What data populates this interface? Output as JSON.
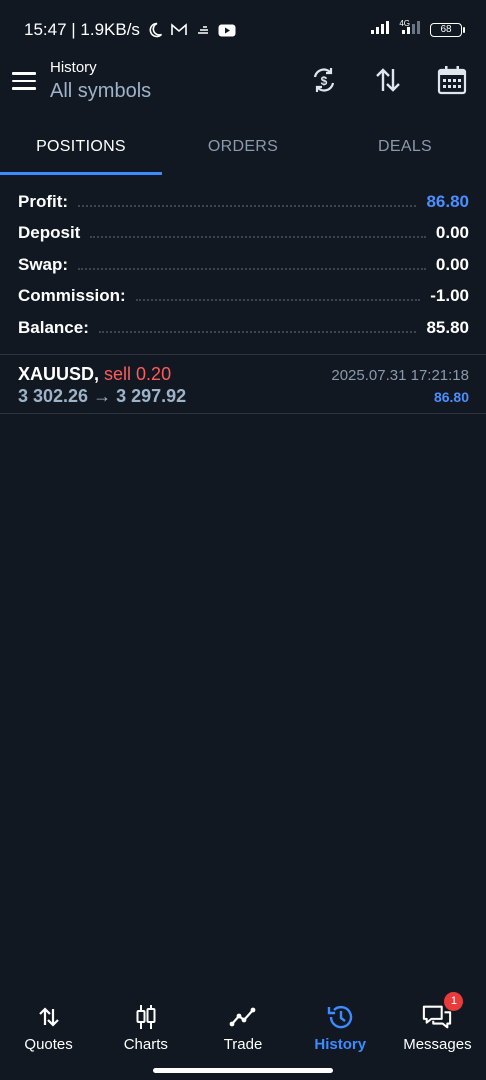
{
  "status_bar": {
    "time_speed": "15:47 | 1.9KB/s",
    "network_label": "4G",
    "battery": "68",
    "icons": [
      "moon-icon",
      "gmail-icon",
      "cloud-icon",
      "youtube-icon",
      "signal-icon",
      "signal-4g-icon",
      "battery-icon"
    ]
  },
  "app_bar": {
    "title": "History",
    "subtitle": "All symbols",
    "actions": [
      "currency-exchange-icon",
      "sort-icon",
      "calendar-icon"
    ]
  },
  "tabs": [
    {
      "label": "POSITIONS",
      "active": true
    },
    {
      "label": "ORDERS",
      "active": false
    },
    {
      "label": "DEALS",
      "active": false
    }
  ],
  "summary": [
    {
      "label": "Profit:",
      "value": "86.80",
      "highlight": true
    },
    {
      "label": "Deposit",
      "value": "0.00",
      "highlight": false
    },
    {
      "label": "Swap:",
      "value": "0.00",
      "highlight": false
    },
    {
      "label": "Commission:",
      "value": "-1.00",
      "highlight": false
    },
    {
      "label": "Balance:",
      "value": "85.80",
      "highlight": false
    }
  ],
  "position": {
    "symbol": "XAUUSD,",
    "side": "sell 0.20",
    "prices": "3 302.26 → 3 297.92",
    "time": "2025.07.31 17:21:18",
    "profit": "86.80"
  },
  "bottom_nav": [
    {
      "label": "Quotes",
      "icon": "quotes-arrows-icon",
      "active": false
    },
    {
      "label": "Charts",
      "icon": "candlestick-icon",
      "active": false
    },
    {
      "label": "Trade",
      "icon": "trend-line-icon",
      "active": false
    },
    {
      "label": "History",
      "icon": "history-clock-icon",
      "active": true
    },
    {
      "label": "Messages",
      "icon": "messages-icon",
      "active": false,
      "badge": "1"
    }
  ],
  "colors": {
    "background": "#111822",
    "accent": "#3d8bff",
    "profit": "#4c8dff",
    "sell": "#ff5b5b",
    "muted": "#8a99ab"
  }
}
